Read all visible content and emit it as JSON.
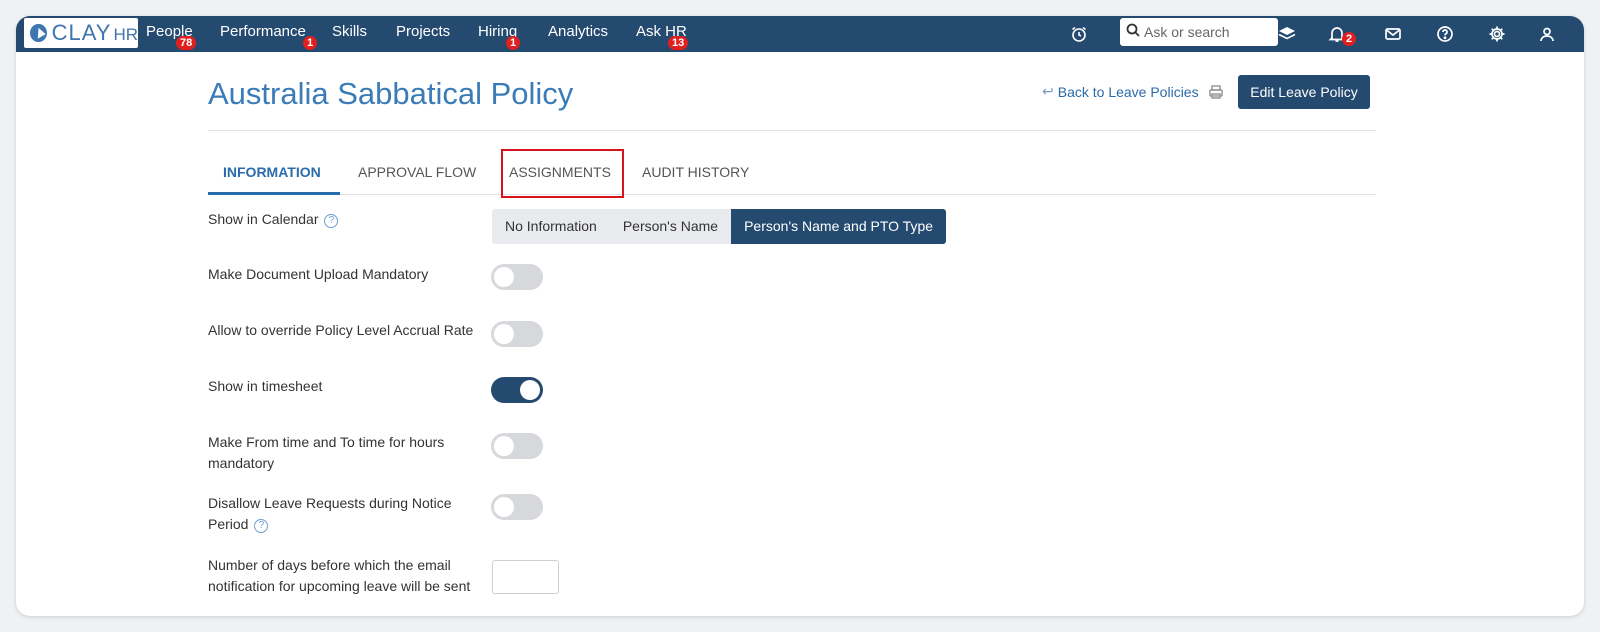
{
  "logo": {
    "clay": "CLAY",
    "hr": "HR"
  },
  "nav": [
    {
      "label": "People",
      "badge": "78"
    },
    {
      "label": "Performance",
      "badge": "1"
    },
    {
      "label": "Skills",
      "badge": ""
    },
    {
      "label": "Projects",
      "badge": ""
    },
    {
      "label": "Hiring",
      "badge": "1"
    },
    {
      "label": "Analytics",
      "badge": ""
    },
    {
      "label": "Ask HR",
      "badge": "13"
    }
  ],
  "search": {
    "placeholder": "Ask or search"
  },
  "top_icons": [
    "alarm-clock-icon",
    "layers-icon",
    "bell-icon",
    "mail-icon",
    "help-circle-icon",
    "gear-icon",
    "user-icon"
  ],
  "notifications_badge": "2",
  "page": {
    "title": "Australia Sabbatical Policy",
    "back_link": "Back to Leave Policies",
    "edit_button": "Edit Leave Policy"
  },
  "tabs": [
    {
      "label": "INFORMATION",
      "active": true
    },
    {
      "label": "APPROVAL FLOW",
      "active": false
    },
    {
      "label": "ASSIGNMENTS",
      "active": false,
      "highlighted": true
    },
    {
      "label": "AUDIT HISTORY",
      "active": false
    }
  ],
  "settings": {
    "show_in_calendar": {
      "label": "Show in Calendar",
      "options": [
        "No Information",
        "Person's Name",
        "Person's Name and PTO Type"
      ],
      "selected": "Person's Name and PTO Type"
    },
    "doc_upload_mandatory": {
      "label": "Make Document Upload Mandatory",
      "on": false
    },
    "override_accrual": {
      "label": "Allow to override Policy Level Accrual Rate",
      "on": false
    },
    "show_in_timesheet": {
      "label": "Show in timesheet",
      "on": true
    },
    "from_to_mandatory": {
      "label_line1": "Make From time and To time for hours",
      "label_line2": "mandatory",
      "on": false
    },
    "disallow_notice": {
      "label_line1": "Disallow Leave Requests during Notice",
      "label_line2": "Period",
      "on": false
    },
    "email_days": {
      "label_line1": "Number of days before which the email",
      "label_line2": "notification for upcoming leave will be sent",
      "value": ""
    }
  },
  "colors": {
    "navy": "#244a70",
    "accent": "#2a6bab",
    "badge": "#e0201f",
    "highlight": "#d6141c"
  }
}
